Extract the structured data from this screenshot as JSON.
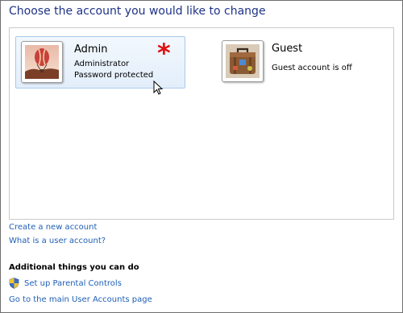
{
  "page": {
    "title": "Choose the account you would like to change"
  },
  "accounts": [
    {
      "name": "Admin",
      "lines": [
        "Administrator",
        "Password protected"
      ],
      "picture_icon": "hot-air-balloon-icon",
      "selected": true
    },
    {
      "name": "Guest",
      "lines": [
        "Guest account is off"
      ],
      "picture_icon": "suitcase-icon",
      "selected": false
    }
  ],
  "annotation": {
    "marker": "*",
    "color": "#e01010"
  },
  "links": {
    "create_account": "Create a new account",
    "what_is_account": "What is a user account?"
  },
  "additional": {
    "heading": "Additional things you can do",
    "parental_controls": "Set up Parental Controls",
    "main_page": "Go to the main User Accounts page"
  },
  "colors": {
    "title": "#1e3287",
    "link": "#1f5fb5",
    "selected_tile": "#e3eefb"
  }
}
